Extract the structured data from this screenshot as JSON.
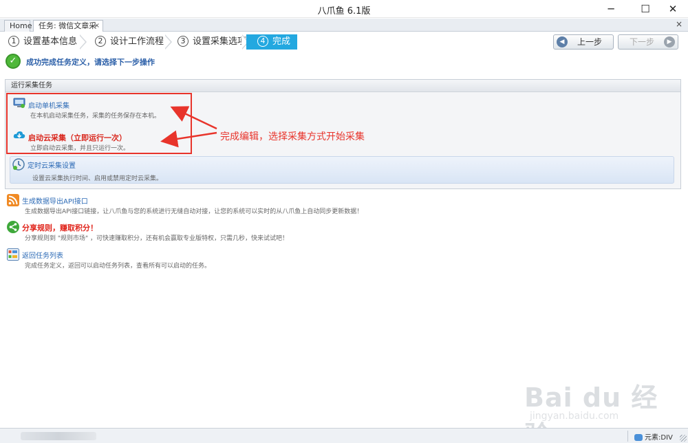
{
  "window": {
    "title": "八爪鱼 6.1版",
    "min_glyph": "─",
    "max_glyph": "☐",
    "close_glyph": "✕"
  },
  "tabs": [
    {
      "label": "Home"
    },
    {
      "label": "任务: 微信文章采集",
      "close_glyph": "×"
    }
  ],
  "tabbar_close_glyph": "×",
  "steps": [
    {
      "num": "1",
      "label": "设置基本信息"
    },
    {
      "num": "2",
      "label": "设计工作流程"
    },
    {
      "num": "3",
      "label": "设置采集选项"
    },
    {
      "num": "4",
      "label": "完成"
    }
  ],
  "nav": {
    "prev_label": "上一步",
    "next_label": "下一步"
  },
  "success": {
    "check_glyph": "✓",
    "message": "成功完成任务定义，请选择下一步操作"
  },
  "run_panel": {
    "header": "运行采集任务",
    "options": [
      {
        "title": "启动单机采集",
        "desc": "在本机启动采集任务，采集的任务保存在本机。"
      },
      {
        "title": "启动云采集（立即运行一次）",
        "desc": "立即启动云采集，并且只运行一次。"
      },
      {
        "title": "定时云采集设置",
        "desc": "设置云采集执行时间、启用或禁用定时云采集。"
      }
    ]
  },
  "annotation": "完成编辑，选择采集方式开始采集",
  "items": [
    {
      "title": "生成数据导出API接口",
      "desc": "生成数据导出API接口链接，让八爪鱼与您的系统进行无缝自动对接，让您的系统可以实时的从八爪鱼上自动同步更新数据！"
    },
    {
      "title": "分享规则，赚取积分！",
      "desc": "分享规则到 \"规则市场\" ，可快速赚取积分，还有机会赢取专业版特权，只需几秒，快来试试吧！"
    },
    {
      "title": "返回任务列表",
      "desc": "完成任务定义，返回可以启动任务列表，查看所有可以启动的任务。"
    }
  ],
  "watermark": {
    "logo": "Bai du 经验",
    "url": "jingyan.baidu.com"
  },
  "status": {
    "element_label": "元素:DIV"
  }
}
